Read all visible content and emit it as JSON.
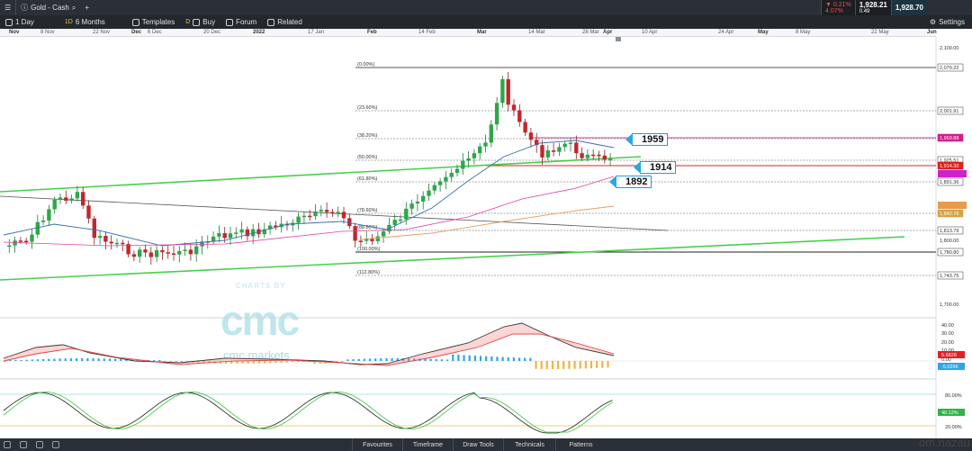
{
  "topbar": {
    "instrument": "Gold - Cash",
    "interval": "1 Day",
    "range_badge": "1D",
    "range": "6 Months",
    "templates": "Templates",
    "buy_badge": "D",
    "buy": "Buy",
    "forum": "Forum",
    "related": "Related",
    "change_pct": "▼ 0.21%",
    "change_sub": "4.07%",
    "sell_price": "1,928.21",
    "spread": "0.49",
    "buy_price": "1,928.70",
    "settings": "Settings"
  },
  "date_axis": [
    {
      "label": "Nov",
      "major": true
    },
    {
      "label": "8 Nov",
      "major": false
    },
    {
      "label": "22 Nov",
      "major": false
    },
    {
      "label": "Dec",
      "major": true
    },
    {
      "label": "6 Dec",
      "major": false
    },
    {
      "label": "20 Dec",
      "major": false
    },
    {
      "label": "2022",
      "major": true
    },
    {
      "label": "17 Jan",
      "major": false
    },
    {
      "label": "Feb",
      "major": true
    },
    {
      "label": "14 Feb",
      "major": false
    },
    {
      "label": "Mar",
      "major": true
    },
    {
      "label": "14 Mar",
      "major": false
    },
    {
      "label": "28 Mar",
      "major": false
    },
    {
      "label": "Apr",
      "major": true
    },
    {
      "label": "10 Apr",
      "major": false
    },
    {
      "label": "24 Apr",
      "major": false
    },
    {
      "label": "May",
      "major": true
    },
    {
      "label": "8 May",
      "major": false
    },
    {
      "label": "22 May",
      "major": false
    },
    {
      "label": "Jun",
      "major": true
    }
  ],
  "price_scale": {
    "levels": [
      "2,100.00",
      "2,070.22",
      "2,001.91",
      "1,959.88",
      "1,925.51",
      "1,914.30",
      "1,891.36",
      "1,842.76",
      "1,813.79",
      "1,800.00",
      "1,780.80",
      "1,743.75",
      "1,700.00"
    ],
    "macd_levels": [
      "40.00",
      "30.00",
      "20.00",
      "10.00",
      "0.00"
    ],
    "macd_tags": [
      "5.6828",
      "-5.0296"
    ],
    "stoch_levels": [
      "80.00%",
      "20.00%"
    ],
    "stoch_tag": "40.12%"
  },
  "fibonacci": [
    "(0.00%)",
    "(23.60%)",
    "(38.20%)",
    "(50.00%)",
    "(61.80%)",
    "(78.60%)",
    "(88.60%)",
    "(100.00%)",
    "(112.80%)"
  ],
  "callouts": {
    "level_1959": "1959",
    "level_1914": "1914",
    "level_1892": "1892"
  },
  "watermark": {
    "charts_by": "CHARTS BY",
    "logo": "cmc",
    "brand": "cmc markets"
  },
  "bottom": {
    "favourites": "Favourites",
    "timeframe": "Timeframe",
    "draw_tools": "Draw Tools",
    "technicals": "Technicals",
    "patterns": "Patterns"
  },
  "footer_mark": "om.nazau",
  "colors": {
    "up": "#2ca84a",
    "down": "#c1272d",
    "magenta": "#e040a0",
    "red_line": "#e0201e",
    "green_channel": "#44d14a"
  }
}
